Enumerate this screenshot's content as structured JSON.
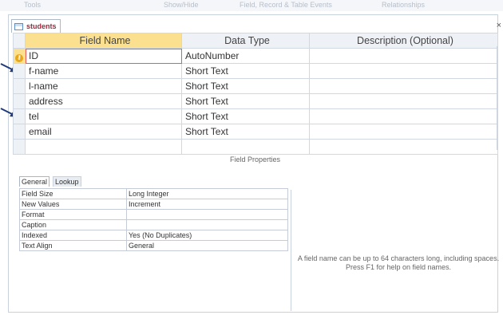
{
  "top_strip": [
    "Tools",
    "Show/Hide",
    "Field, Record & Table Events",
    "Relationships"
  ],
  "document_tab": {
    "label": "students",
    "close_glyph": "×"
  },
  "grid": {
    "headers": {
      "field_name": "Field Name",
      "data_type": "Data Type",
      "description": "Description (Optional)"
    },
    "rows": [
      {
        "name": "ID",
        "type": "AutoNumber",
        "description": "",
        "primary_key": true
      },
      {
        "name": "f-name",
        "type": "Short Text",
        "description": ""
      },
      {
        "name": "l-name",
        "type": "Short Text",
        "description": ""
      },
      {
        "name": "address",
        "type": "Short Text",
        "description": ""
      },
      {
        "name": "tel",
        "type": "Short Text",
        "description": ""
      },
      {
        "name": "email",
        "type": "Short Text",
        "description": ""
      },
      {
        "name": "",
        "type": "",
        "description": ""
      }
    ]
  },
  "field_properties": {
    "title": "Field Properties",
    "tabs": [
      "General",
      "Lookup"
    ],
    "active_tab": "General",
    "rows": [
      {
        "label": "Field Size",
        "value": "Long Integer"
      },
      {
        "label": "New Values",
        "value": "Increment"
      },
      {
        "label": "Format",
        "value": ""
      },
      {
        "label": "Caption",
        "value": ""
      },
      {
        "label": "Indexed",
        "value": "Yes (No Duplicates)"
      },
      {
        "label": "Text Align",
        "value": "General"
      }
    ],
    "help_text": "A field name can be up to 64 characters long, including spaces. Press F1 for help on field names."
  },
  "colors": {
    "header_highlight": "#fbe08f",
    "tab_text": "#a0273c",
    "focus_border": "#e35c5c",
    "key_icon": "#e8a619",
    "arrow": "#1f3a7a"
  }
}
